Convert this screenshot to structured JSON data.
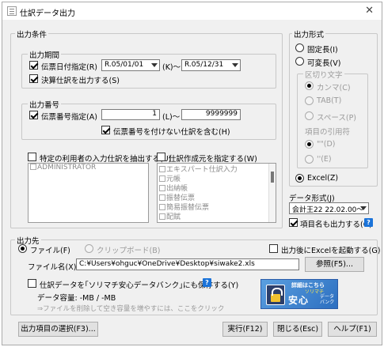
{
  "window": {
    "title": "仕訳データ出力"
  },
  "conditions": {
    "group_label": "出力条件",
    "period": {
      "label": "出力期間",
      "date_check_label": "伝票日付指定(R)",
      "date_from": "R.05/01/01",
      "date_from_suffix": "(K)～",
      "date_to": "R.05/12/31",
      "settlement_label": "決算仕訳を出力する(S)"
    },
    "number": {
      "label": "出力番号",
      "num_check_label": "伝票番号指定(A)",
      "num_from": "1",
      "num_from_suffix": "(L)～",
      "num_to": "9999999",
      "include_unnumbered_label": "伝票番号を付けない仕訳を含む(H)"
    },
    "user_filter": {
      "label": "特定の利用者の入力仕訳を抽出する(U)",
      "items": [
        "ADMINISTRATOR"
      ]
    },
    "creator_filter": {
      "label": "仕訳作成元を指定する(W)",
      "items": [
        "エキスパート仕訳入力",
        "元帳",
        "出納帳",
        "振替伝票",
        "簡易振替伝票",
        "配賦"
      ]
    }
  },
  "format": {
    "group_label": "出力形式",
    "fixed_label": "固定長(I)",
    "variable_label": "可変長(V)",
    "delimiter_group_label": "区切り文字",
    "comma_label": "カンマ(C)",
    "tab_label": "TAB(T)",
    "space_label": "スペース(P)",
    "quote_group_label": "項目の引用符",
    "dquote_label": "\"\"(D)",
    "squote_label": "''(E)",
    "excel_label": "Excel(Z)"
  },
  "data_format": {
    "label": "データ形式(J)",
    "selected": "会計王22 22.02.00～",
    "item_names_label": "項目名も出力する(O)",
    "help_icon": "?"
  },
  "destination": {
    "group_label": "出力先",
    "file_label": "ファイル(F)",
    "clipboard_label": "クリップボード(B)",
    "launch_excel_label": "出力後にExcelを起動する(G)",
    "filename_label": "ファイル名(X)",
    "filename_value": "C:¥Users¥ohguc¥OneDrive¥Desktop¥siwake2.xls",
    "browse_label": "参照(F5)...",
    "soreca_label": "仕訳データを｢ソリマチ安心データバンク｣にも保存する(Y)",
    "help_icon": "?",
    "capacity_text": "データ容量: -MB / -MB",
    "capacity_hint": "⇒ファイルを削除して空き容量を増やすには、ここをクリック",
    "banner": {
      "line1": "詳細はこちら",
      "line2": "ソリマチ",
      "line3": "安心",
      "line4": "データバンク"
    }
  },
  "footer": {
    "select_items_label": "出力項目の選択(F3)...",
    "execute_label": "実行(F12)",
    "close_label": "閉じる(Esc)",
    "help_label": "ヘルプ(F1)"
  }
}
